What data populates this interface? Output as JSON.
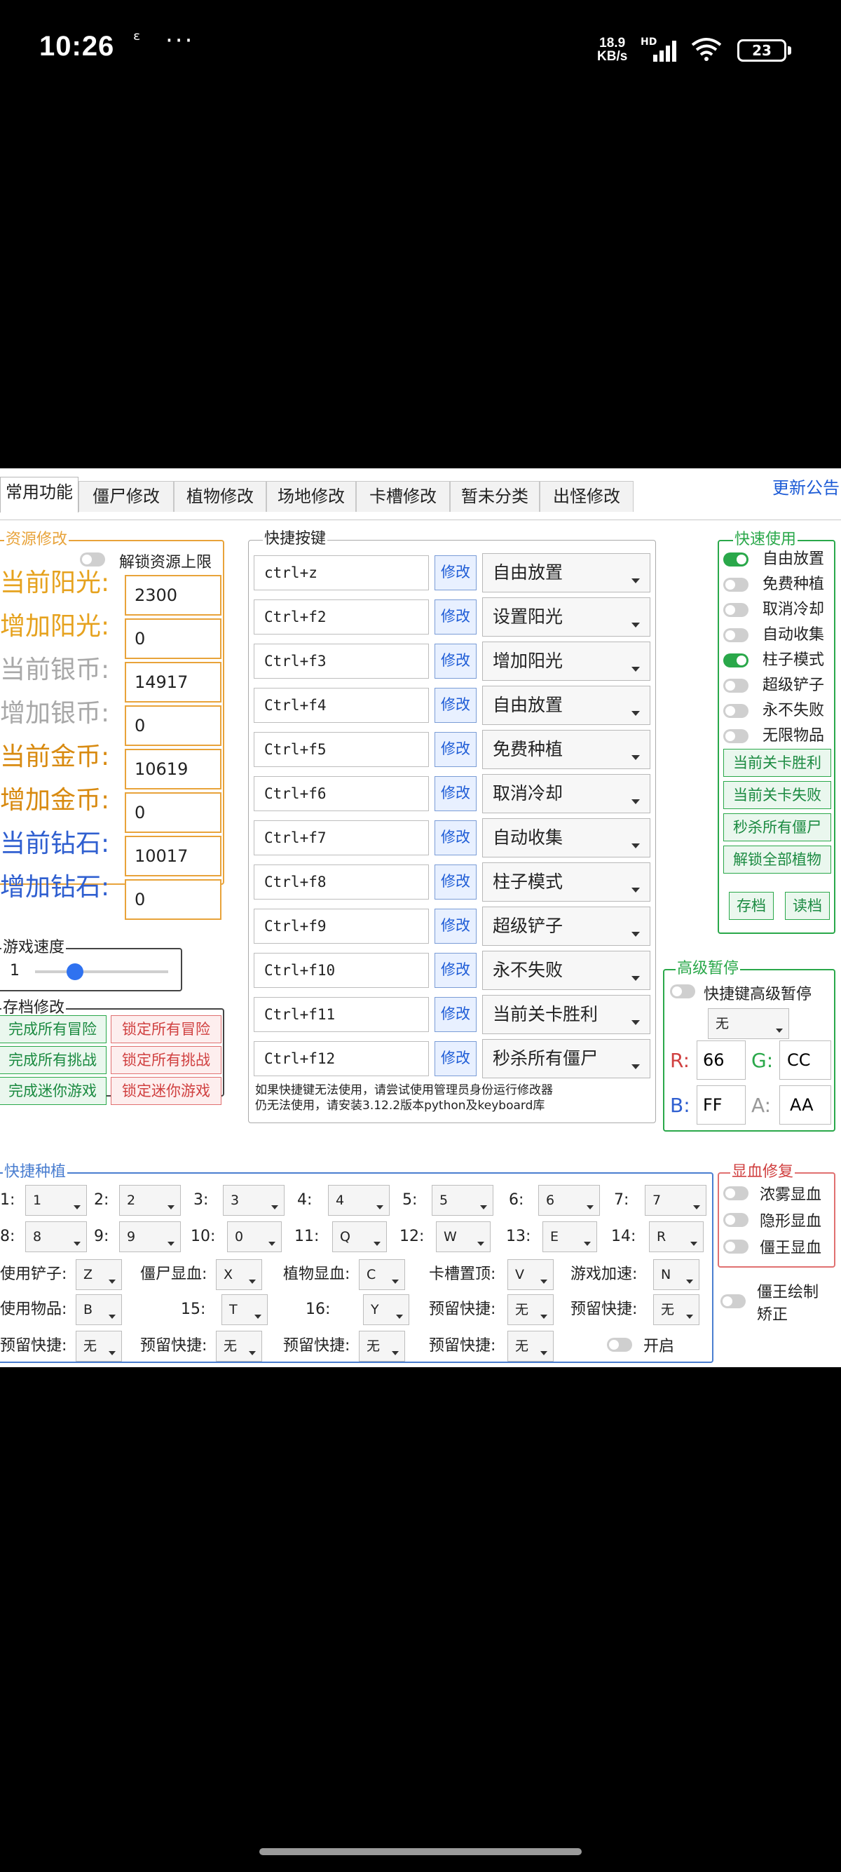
{
  "status_bar": {
    "time": "10:26",
    "extra": "ᵋ",
    "dots": "···",
    "speed_value": "18.9",
    "speed_unit": "KB/s",
    "hd": "HD",
    "battery": "23"
  },
  "tabs": [
    "常用功能",
    "僵尸修改",
    "植物修改",
    "场地修改",
    "卡槽修改",
    "暂未分类",
    "出怪修改"
  ],
  "notice": "更新公告",
  "resources": {
    "title": "资源修改",
    "unlock_label": "解锁资源上限",
    "rows": [
      {
        "label": "当前阳光:",
        "value": "2300",
        "color": "#e6a21e"
      },
      {
        "label": "增加阳光:",
        "value": "0",
        "color": "#e6a21e"
      },
      {
        "label": "当前银币:",
        "value": "14917",
        "color": "#a8a8a8"
      },
      {
        "label": "增加银币:",
        "value": "0",
        "color": "#a8a8a8"
      },
      {
        "label": "当前金币:",
        "value": "10619",
        "color": "#d88a10"
      },
      {
        "label": "增加金币:",
        "value": "0",
        "color": "#d88a10"
      },
      {
        "label": "当前钻石:",
        "value": "10017",
        "color": "#2f5fd0"
      },
      {
        "label": "增加钻石:",
        "value": "0",
        "color": "#2f5fd0"
      }
    ]
  },
  "game_speed": {
    "title": "游戏速度",
    "value": "1",
    "level": 0.3
  },
  "save": {
    "title": "存档修改",
    "buttons_left": [
      "完成所有冒险",
      "完成所有挑战",
      "完成迷你游戏"
    ],
    "buttons_right": [
      "锁定所有冒险",
      "锁定所有挑战",
      "锁定迷你游戏"
    ]
  },
  "hotkeys": {
    "title": "快捷按键",
    "edit_label": "修改",
    "rows": [
      {
        "key": "ctrl+z",
        "action": "自由放置"
      },
      {
        "key": "Ctrl+f2",
        "action": "设置阳光"
      },
      {
        "key": "Ctrl+f3",
        "action": "增加阳光"
      },
      {
        "key": "Ctrl+f4",
        "action": "自由放置"
      },
      {
        "key": "Ctrl+f5",
        "action": "免费种植"
      },
      {
        "key": "Ctrl+f6",
        "action": "取消冷却"
      },
      {
        "key": "Ctrl+f7",
        "action": "自动收集"
      },
      {
        "key": "Ctrl+f8",
        "action": "柱子模式"
      },
      {
        "key": "Ctrl+f9",
        "action": "超级铲子"
      },
      {
        "key": "Ctrl+f10",
        "action": "永不失败"
      },
      {
        "key": "Ctrl+f11",
        "action": "当前关卡胜利"
      },
      {
        "key": "Ctrl+f12",
        "action": "秒杀所有僵尸"
      }
    ],
    "note_line1": "如果快捷键无法使用，请尝试使用管理员身份运行修改器",
    "note_line2": "仍无法使用，请安装3.12.2版本python及keyboard库"
  },
  "quick_use": {
    "title": "快速使用",
    "toggles": [
      {
        "label": "自由放置",
        "on": true
      },
      {
        "label": "免费种植",
        "on": false
      },
      {
        "label": "取消冷却",
        "on": false
      },
      {
        "label": "自动收集",
        "on": false
      },
      {
        "label": "柱子模式",
        "on": true
      },
      {
        "label": "超级铲子",
        "on": false
      },
      {
        "label": "永不失败",
        "on": false
      },
      {
        "label": "无限物品",
        "on": false
      }
    ],
    "buttons": [
      "当前关卡胜利",
      "当前关卡失败",
      "秒杀所有僵尸",
      "解锁全部植物"
    ],
    "save_label": "存档",
    "load_label": "读档"
  },
  "advanced_pause": {
    "title": "高级暂停",
    "toggle_label": "快捷键高级暂停",
    "select_value": "无",
    "r_label": "R:",
    "r_value": "66",
    "g_label": "G:",
    "g_value": "CC",
    "b_label": "B:",
    "b_value": "FF",
    "a_label": "A:",
    "a_value": "AA"
  },
  "quick_plant": {
    "title": "快捷种植",
    "slots": [
      {
        "label": "1:",
        "value": "1"
      },
      {
        "label": "2:",
        "value": "2"
      },
      {
        "label": "3:",
        "value": "3"
      },
      {
        "label": "4:",
        "value": "4"
      },
      {
        "label": "5:",
        "value": "5"
      },
      {
        "label": "6:",
        "value": "6"
      },
      {
        "label": "7:",
        "value": "7"
      },
      {
        "label": "8:",
        "value": "8"
      },
      {
        "label": "9:",
        "value": "9"
      },
      {
        "label": "10:",
        "value": "0"
      },
      {
        "label": "11:",
        "value": "Q"
      },
      {
        "label": "12:",
        "value": "W"
      },
      {
        "label": "13:",
        "value": "E"
      },
      {
        "label": "14:",
        "value": "R"
      }
    ],
    "row3": [
      {
        "label": "使用铲子:",
        "value": "Z"
      },
      {
        "label": "僵尸显血:",
        "value": "X"
      },
      {
        "label": "植物显血:",
        "value": "C"
      },
      {
        "label": "卡槽置顶:",
        "value": "V"
      },
      {
        "label": "游戏加速:",
        "value": "N"
      }
    ],
    "row4": [
      {
        "label": "使用物品:",
        "value": "B"
      },
      {
        "label": "15:",
        "value": "T"
      },
      {
        "label": "16:",
        "value": "Y"
      },
      {
        "label": "预留快捷:",
        "value": "无"
      },
      {
        "label": "预留快捷:",
        "value": "无"
      }
    ],
    "row5": [
      {
        "label": "预留快捷:",
        "value": "无"
      },
      {
        "label": "预留快捷:",
        "value": "无"
      },
      {
        "label": "预留快捷:",
        "value": "无"
      },
      {
        "label": "预留快捷:",
        "value": "无"
      }
    ],
    "open_label": "开启"
  },
  "blood_display": {
    "title": "显血修复",
    "toggles": [
      "浓雾显血",
      "隐形显血",
      "僵王显血"
    ],
    "boss_label_line1": "僵王绘制",
    "boss_label_line2": "矫正"
  }
}
